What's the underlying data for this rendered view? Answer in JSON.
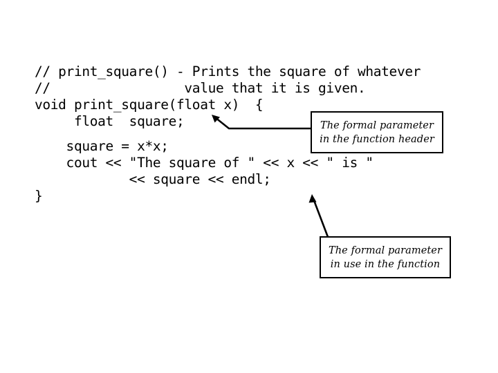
{
  "slide": {
    "background_color": "#ffffff",
    "text_color": "#000000"
  },
  "code": {
    "language": "cpp",
    "lines": [
      "// print_square() - Prints the square of whatever",
      "//                 value that it is given.",
      "void print_square(float x)  {",
      "     float  square;",
      "",
      "    square = x*x;",
      "    cout << \"The square of \" << x << \" is \"",
      "            << square << endl;",
      "}"
    ]
  },
  "callouts": [
    {
      "id": "formal-parameter-header",
      "line1": "The formal parameter",
      "line2": "in the function header"
    },
    {
      "id": "formal-parameter-use",
      "line1": "The formal parameter",
      "line2": "in use in the function"
    }
  ],
  "connectors": {
    "header_arrow": "arrow-to-parameter-x",
    "body_arrow": "arrow-to-square-variable",
    "stroke_color": "#000000"
  }
}
